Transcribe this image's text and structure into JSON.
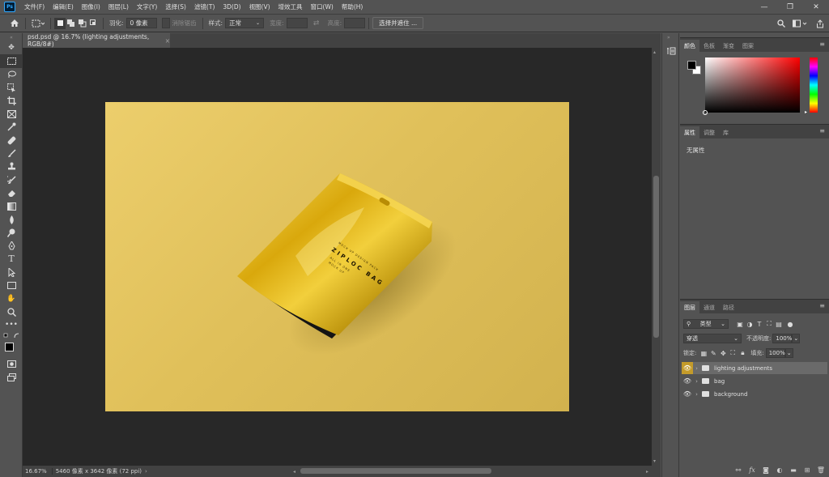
{
  "menubar": {
    "app_icon": "Ps",
    "items": [
      "文件(F)",
      "编辑(E)",
      "图像(I)",
      "图层(L)",
      "文字(Y)",
      "选择(S)",
      "滤镜(T)",
      "3D(D)",
      "视图(V)",
      "增效工具",
      "窗口(W)",
      "帮助(H)"
    ],
    "controls": [
      "—",
      "❐",
      "✕"
    ]
  },
  "options": {
    "feather_label": "羽化:",
    "feather_value": "0 像素",
    "antialias_label": "消除锯齿",
    "style_label": "样式:",
    "style_value": "正常",
    "width_label": "宽度:",
    "height_label": "高度:",
    "select_mask_button": "选择并遮住 ..."
  },
  "document": {
    "tab_title": "psd.psd @ 16.7% (lighting adjustments, RGB/8#)",
    "close": "×"
  },
  "artwork": {
    "bag_title": "ZIPLOC BAG",
    "bag_sub_top": "MOCK UP DESIGN PACK",
    "bag_sub_lines": [
      "ALL IN ONE",
      "MOCK UP"
    ],
    "colors": {
      "background": "#e0c05a",
      "bag": "#d6a80a",
      "bag_highlight": "#f5d85a",
      "bag_shadow": "#8a6a00"
    }
  },
  "status": {
    "zoom": "16.67%",
    "info": "5460 像素 x 3642 像素 (72 ppi)",
    "arrow": "›"
  },
  "color_panel": {
    "tabs": [
      "颜色",
      "色板",
      "渐变",
      "图案"
    ]
  },
  "properties_panel": {
    "tabs": [
      "属性",
      "调整",
      "库"
    ],
    "empty_text": "无属性"
  },
  "layers_panel": {
    "tabs": [
      "图层",
      "通道",
      "路径"
    ],
    "filter_label": "类型",
    "blend_mode": "穿透",
    "opacity_label": "不透明度:",
    "opacity_value": "100%",
    "lock_label": "锁定:",
    "fill_label": "填充:",
    "fill_value": "100%",
    "layers": [
      {
        "name": "lighting adjustments",
        "selected": true
      },
      {
        "name": "bag",
        "selected": false
      },
      {
        "name": "background",
        "selected": false
      }
    ]
  }
}
